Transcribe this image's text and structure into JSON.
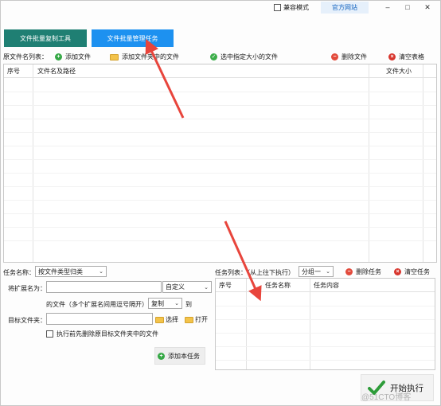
{
  "titlebar": {
    "compat_mode_label": "兼容模式",
    "official_site_label": "官方网站"
  },
  "tabs": [
    {
      "label": "文件批量复制工具"
    },
    {
      "label": "文件批量管理任务"
    }
  ],
  "source_toolbar": {
    "label": "原文件名列表：",
    "add_file": "添加文件",
    "add_folder_files": "添加文件夹中的文件",
    "select_by_size": "选中指定大小的文件",
    "delete_file": "删除文件",
    "clear_table": "清空表格"
  },
  "source_table": {
    "columns": [
      "序号",
      "文件名及路径",
      "文件大小"
    ],
    "rows": []
  },
  "task_form": {
    "task_name_label": "任务名称：",
    "task_name_value": "按文件类型归类",
    "ext_label": "将扩展名为：",
    "ext_value": "",
    "ext_mode_value": "自定义",
    "ext_hint": "的文件（多个扩展名间用逗号隔开）",
    "action_value": "复制",
    "to_label": "到",
    "target_label": "目标文件夹：",
    "target_value": "",
    "choose_label": "选择",
    "open_label": "打开",
    "delete_first_label": "执行前先删除原目标文件夹中的文件",
    "add_task_label": "添加本任务"
  },
  "task_list": {
    "label": "任务列表：（从上往下执行）",
    "group_value": "分组一",
    "delete_task": "删除任务",
    "clear_tasks": "清空任务",
    "columns": [
      "序号",
      "任务名称",
      "任务内容"
    ],
    "rows": []
  },
  "start_button_label": "开始执行",
  "watermark": "@51CTO博客",
  "colors": {
    "tab_copy_bg": "#1f7f73",
    "tab_manage_bg": "#1d91f0",
    "annotation_arrow": "#e8453c"
  }
}
